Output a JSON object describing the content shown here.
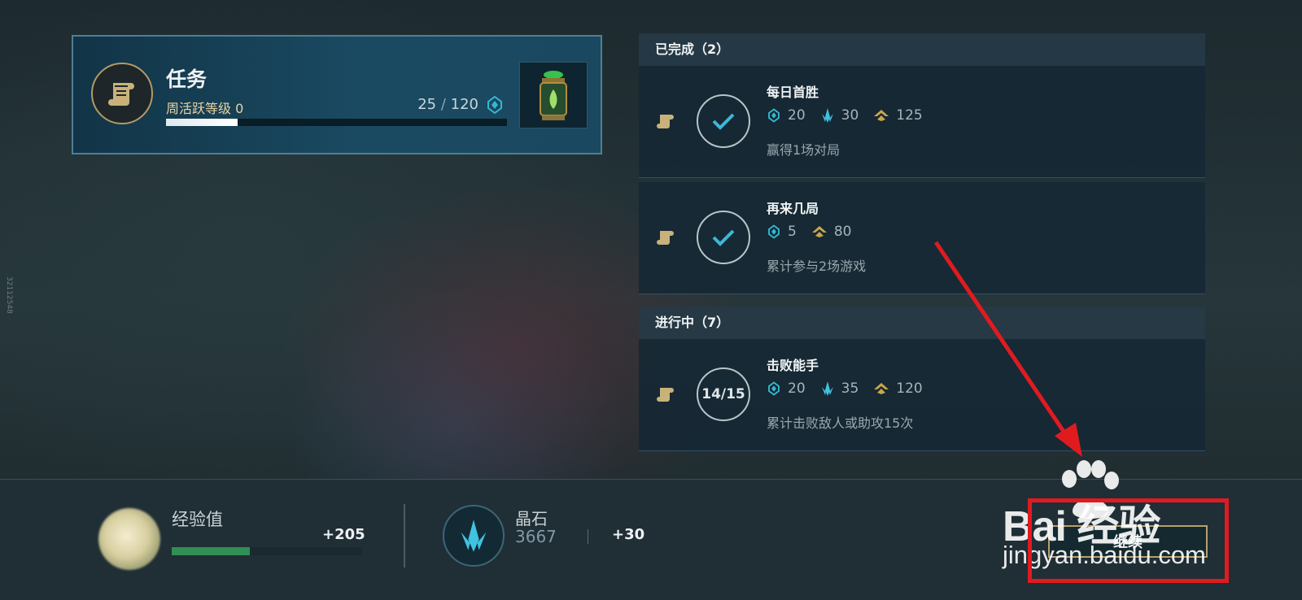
{
  "side_text": "32112548",
  "mission": {
    "title": "任务",
    "subtitle": "周活跃等级 0",
    "progress_current": "25",
    "progress_sep": "/",
    "progress_total": "120",
    "progress_fraction": 0.21,
    "icon": "blue-essence-icon",
    "emblem_icon": "scroll-icon",
    "reward_icon": "lantern-capsule-icon"
  },
  "quests": {
    "completed_header": "已完成（2）",
    "in_progress_header": "进行中（7）",
    "completed": [
      {
        "title": "每日首胜",
        "status_icon": "check-icon",
        "rewards": [
          {
            "icon": "blue-essence-icon",
            "value": "20"
          },
          {
            "icon": "crystal-icon",
            "value": "30"
          },
          {
            "icon": "xp-chevron-icon",
            "value": "125"
          }
        ],
        "desc": "赢得1场对局"
      },
      {
        "title": "再来几局",
        "status_icon": "check-icon",
        "rewards": [
          {
            "icon": "blue-essence-icon",
            "value": "5"
          },
          {
            "icon": "xp-chevron-icon",
            "value": "80"
          }
        ],
        "desc": "累计参与2场游戏"
      }
    ],
    "in_progress": [
      {
        "title": "击败能手",
        "progress": "14/15",
        "rewards": [
          {
            "icon": "blue-essence-icon",
            "value": "20"
          },
          {
            "icon": "crystal-icon",
            "value": "35"
          },
          {
            "icon": "xp-chevron-icon",
            "value": "120"
          }
        ],
        "desc": "累计击败敌人或助攻15次"
      }
    ]
  },
  "bottom": {
    "xp_label": "经验值",
    "xp_gain": "+205",
    "xp_fraction": 0.41,
    "crystal_label": "晶石",
    "crystal_count": "3667",
    "crystal_gain": "+30",
    "continue_label": "继续"
  },
  "watermark": {
    "brand": "Bai  经验",
    "url": "jingyan.baidu.com"
  },
  "colors": {
    "blue_essence": "#35b7d2",
    "xp_gold": "#c9a64a",
    "annotation_red": "#e01b20",
    "border_gold": "#b9a06a"
  }
}
